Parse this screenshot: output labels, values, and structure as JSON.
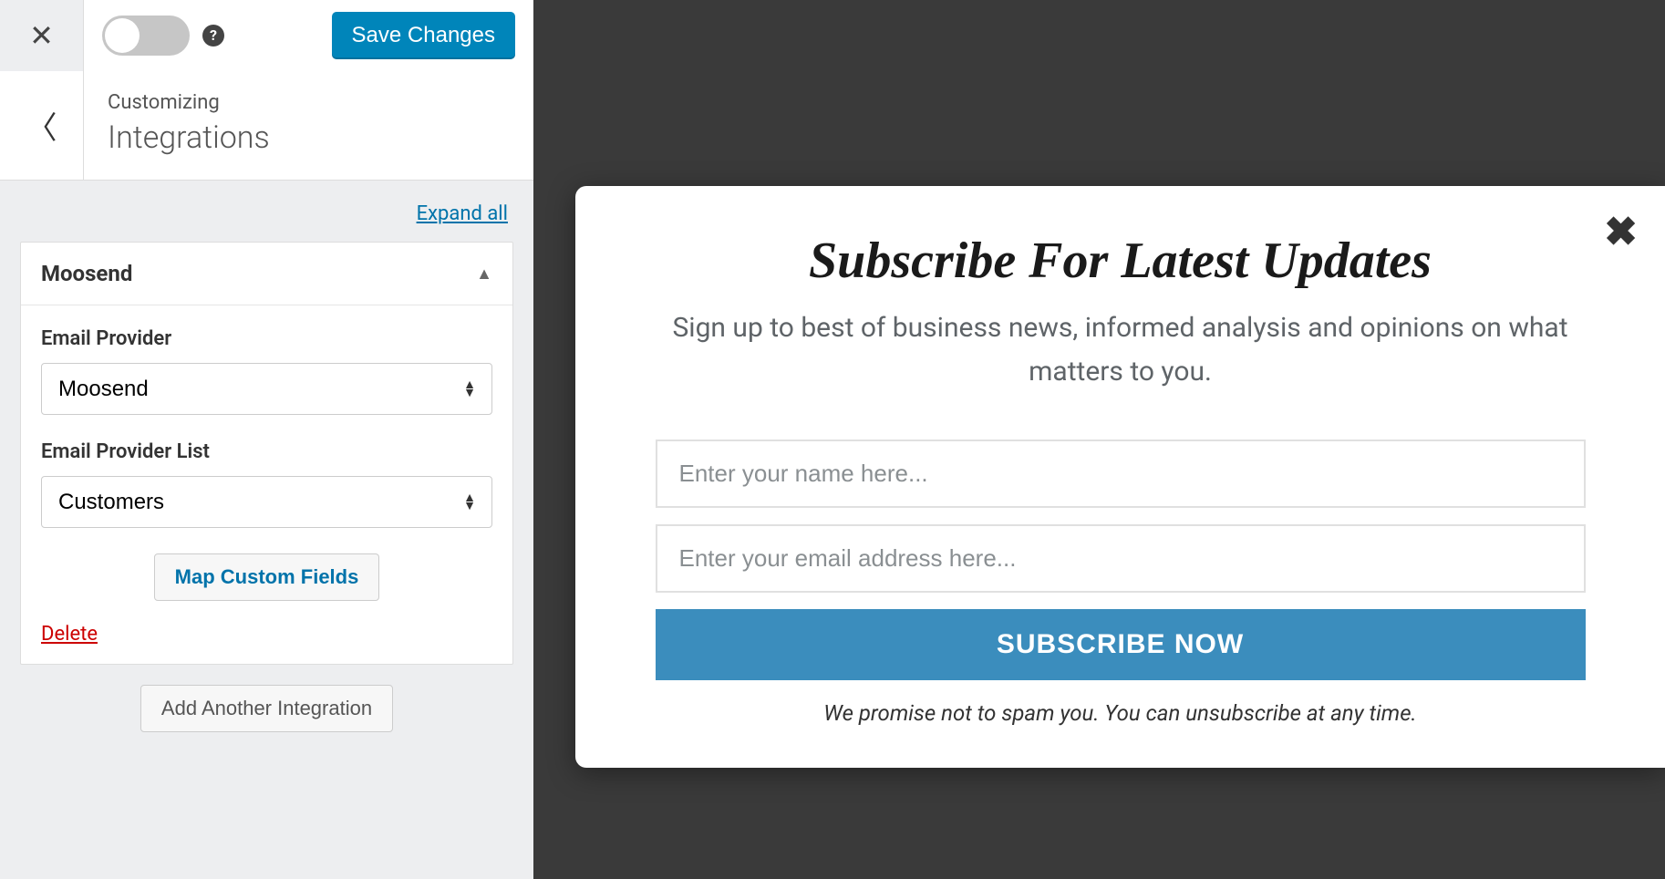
{
  "header": {
    "save_label": "Save Changes"
  },
  "nav": {
    "breadcrumb": "Customizing",
    "title": "Integrations"
  },
  "expand_all": "Expand all",
  "panel": {
    "title": "Moosend",
    "email_provider_label": "Email Provider",
    "email_provider_value": "Moosend",
    "email_list_label": "Email Provider List",
    "email_list_value": "Customers",
    "map_label": "Map Custom Fields",
    "delete_label": "Delete"
  },
  "add_integration_label": "Add Another Integration",
  "popup": {
    "title": "Subscribe For Latest Updates",
    "subtitle": "Sign up to best of business news, informed analysis and opinions on what matters to you.",
    "name_placeholder": "Enter your name here...",
    "email_placeholder": "Enter your email address here...",
    "button_label": "SUBSCRIBE NOW",
    "footnote": "We promise not to spam you. You can unsubscribe at any time."
  }
}
